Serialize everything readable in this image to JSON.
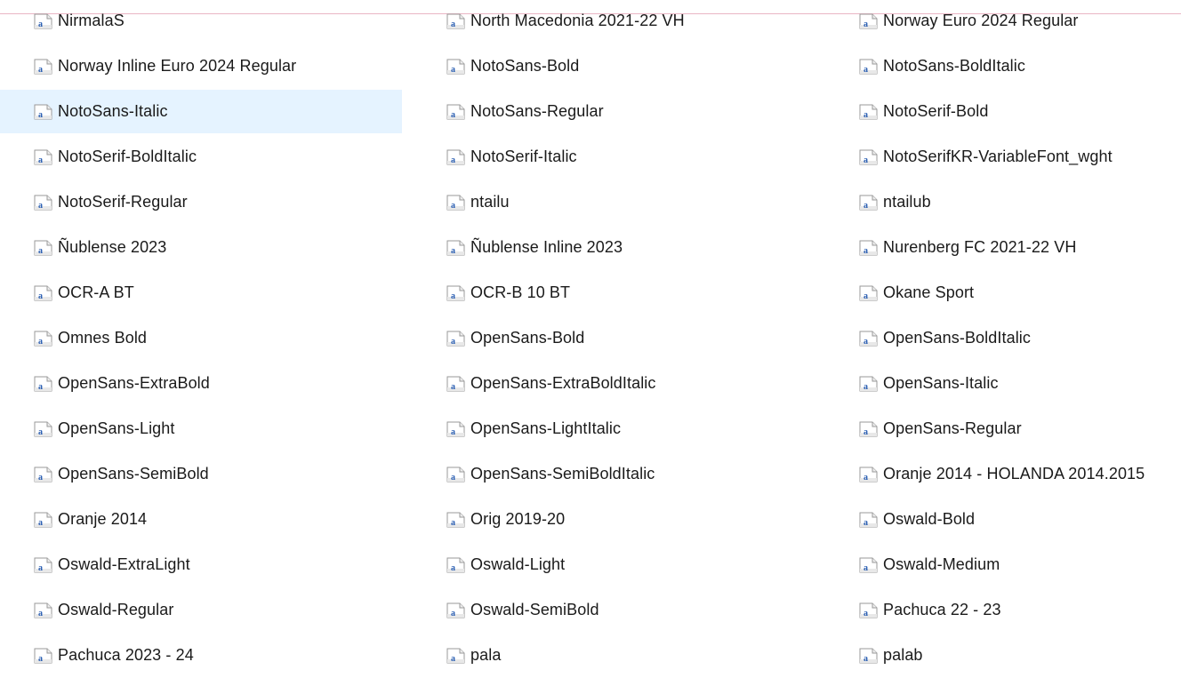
{
  "selected_item": "NotoSans-Italic",
  "files": [
    [
      "NirmalaS",
      "North Macedonia 2021-22 VH",
      "Norway Euro 2024 Regular"
    ],
    [
      "Norway Inline Euro 2024 Regular",
      "NotoSans-Bold",
      "NotoSans-BoldItalic"
    ],
    [
      "NotoSans-Italic",
      "NotoSans-Regular",
      "NotoSerif-Bold"
    ],
    [
      "NotoSerif-BoldItalic",
      "NotoSerif-Italic",
      "NotoSerifKR-VariableFont_wght"
    ],
    [
      "NotoSerif-Regular",
      "ntailu",
      "ntailub"
    ],
    [
      "Ñublense 2023",
      "Ñublense Inline 2023",
      "Nurenberg FC 2021-22 VH"
    ],
    [
      "OCR-A BT",
      "OCR-B 10 BT",
      "Okane Sport"
    ],
    [
      "Omnes Bold",
      "OpenSans-Bold",
      "OpenSans-BoldItalic"
    ],
    [
      "OpenSans-ExtraBold",
      "OpenSans-ExtraBoldItalic",
      "OpenSans-Italic"
    ],
    [
      "OpenSans-Light",
      "OpenSans-LightItalic",
      "OpenSans-Regular"
    ],
    [
      "OpenSans-SemiBold",
      "OpenSans-SemiBoldItalic",
      "Oranje 2014 - HOLANDA 2014.2015"
    ],
    [
      "Oranje 2014",
      "Orig 2019-20",
      "Oswald-Bold"
    ],
    [
      "Oswald-ExtraLight",
      "Oswald-Light",
      "Oswald-Medium"
    ],
    [
      "Oswald-Regular",
      "Oswald-SemiBold",
      "Pachuca 22 - 23"
    ],
    [
      "Pachuca 2023 - 24",
      "pala",
      "palab"
    ]
  ],
  "icons": {
    "file": "font-file-icon"
  },
  "colors": {
    "selection": "#e5f3ff",
    "text": "#1a1a1a",
    "icon_letter": "#2b5fb3"
  }
}
